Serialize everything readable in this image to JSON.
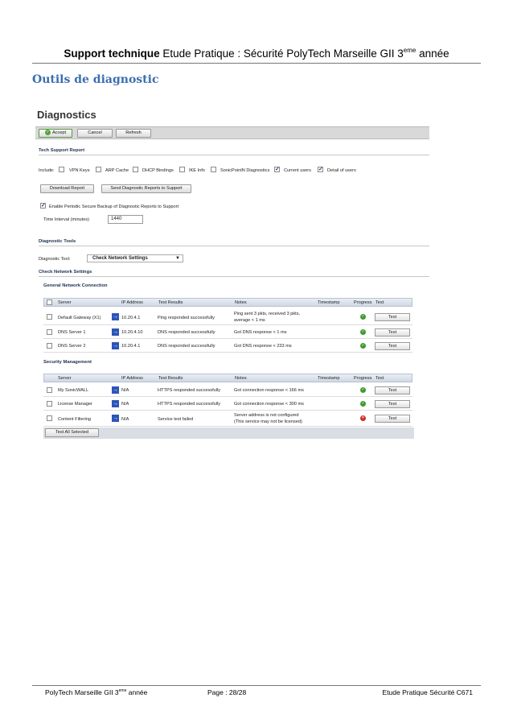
{
  "doc": {
    "header_bold": "Support technique",
    "header_rest": " Etude Pratique : Sécurité PolyTech Marseille GII 3",
    "header_sup": "eme",
    "header_end": " année",
    "section_title": "Outils de diagnostic",
    "footer_left": "PolyTech Marseille GII 3",
    "footer_left_sup": "eme",
    "footer_left_end": " année",
    "footer_mid": "Page : 28/28",
    "footer_right": "Etude Pratique Sécurité C671"
  },
  "screen": {
    "title": "Diagnostics",
    "toolbar": {
      "accept": "Accept",
      "cancel": "Cancel",
      "refresh": "Refresh"
    },
    "tech_support": {
      "heading": "Tech Support Report",
      "include_label": "Include:",
      "options": [
        {
          "label": "VPN Keys",
          "checked": false
        },
        {
          "label": "ARP Cache",
          "checked": false
        },
        {
          "label": "DHCP Bindings",
          "checked": false
        },
        {
          "label": "IKE Info",
          "checked": false
        },
        {
          "label": "SonicPointN Diagnostics",
          "checked": false
        },
        {
          "label": "Current users",
          "checked": true
        },
        {
          "label": "Detail of users",
          "checked": true
        }
      ],
      "download_button": "Download Report",
      "send_button": "Send Diagnostic Reports to Support",
      "periodic_label": "Enable Periodic Secure Backup of Diagnostic Reports to Support",
      "interval_label": "Time Interval (minutes)",
      "interval_value": "1440"
    },
    "diag_tools": {
      "heading": "Diagnostic Tools",
      "tool_label": "Diagnostic Tool:",
      "tool_value": "Check Network Settings"
    },
    "check_heading": "Check Network Settings",
    "columns": {
      "server": "Server",
      "ip": "IP Address",
      "results": "Test Results",
      "notes": "Notes",
      "timestamp": "Timestamp",
      "progress": "Progress",
      "test": "Test"
    },
    "general": {
      "heading": "General Network Connection",
      "rows": [
        {
          "server": "Default Gateway (X1)",
          "ip": "10.20.4.1",
          "result": "Ping responded successfully",
          "note1": "Ping sent 3 pkts, received 3 pkts,",
          "note2": "average < 1 ms",
          "status": "ok",
          "test": "Test"
        },
        {
          "server": "DNS Server 1",
          "ip": "10.20.4.10",
          "result": "DNS responded successfully",
          "note1": "Got DNS response < 1 ms",
          "note2": "",
          "status": "ok",
          "test": "Test"
        },
        {
          "server": "DNS Server 2",
          "ip": "10.20.4.1",
          "result": "DNS responded successfully",
          "note1": "Got DNS response < 233 ms",
          "note2": "",
          "status": "ok",
          "test": "Test"
        }
      ]
    },
    "security": {
      "heading": "Security Management",
      "rows": [
        {
          "server": "My SonicWALL",
          "ip": "N/A",
          "result": "HTTPS responded successfully",
          "note1": "Got connection response < 166 ms",
          "note2": "",
          "status": "ok",
          "test": "Test"
        },
        {
          "server": "License Manager",
          "ip": "N/A",
          "result": "HTTPS responded successfully",
          "note1": "Got connection response < 300 ms",
          "note2": "",
          "status": "ok",
          "test": "Test"
        },
        {
          "server": "Content Filtering",
          "ip": "N/A",
          "result": "Service test failed",
          "note1": "Server address is not configured",
          "note2": "(This service may not be licensed)",
          "status": "error",
          "test": "Test"
        }
      ]
    },
    "test_all": "Test All Selected"
  }
}
